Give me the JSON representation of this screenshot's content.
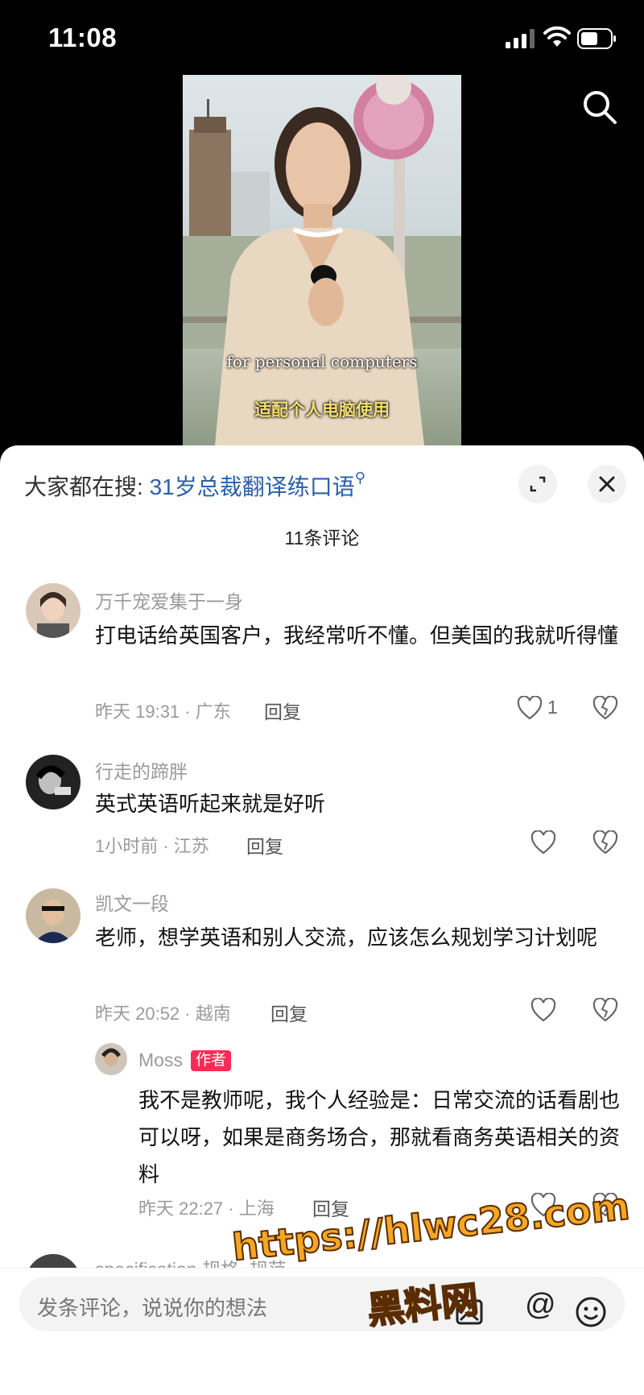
{
  "status": {
    "time": "11:08"
  },
  "video": {
    "subtitle_en": "for personal computers",
    "subtitle_cn": "适配个人电脑使用"
  },
  "sheet": {
    "hot_search_prefix": "大家都在搜: ",
    "hot_search_keyword": "31岁总裁翻译练口语",
    "comment_count": "11条评论"
  },
  "comments": [
    {
      "user": "万千宠爱集于一身",
      "text": "打电话给英国客户，我经常听不懂。但美国的我就听得懂",
      "meta": "昨天 19:31 · 广东",
      "reply_label": "回复",
      "likes": "1"
    },
    {
      "user": "行走的蹄胖",
      "text": "英式英语听起来就是好听",
      "meta": "1小时前 · 江苏",
      "reply_label": "回复",
      "likes": ""
    },
    {
      "user": "凯文一段",
      "text": "老师，想学英语和别人交流，应该怎么规划学习计划呢",
      "meta": "昨天 20:52 · 越南",
      "reply_label": "回复",
      "likes": ""
    }
  ],
  "author_reply": {
    "user": "Moss",
    "badge": "作者",
    "text": "我不是教师呢，我个人经验是：日常交流的话看剧也可以呀，如果是商务场合，那就看商务英语相关的资料",
    "meta": "昨天 22:27 · 上海",
    "reply_label": "回复"
  },
  "partial_next_user": "specification 规格, 规范",
  "input": {
    "placeholder": "发条评论，说说你的想法",
    "at_symbol": "@"
  },
  "watermark": {
    "line1": "https://hlwc28.com",
    "line2": "黑料网"
  },
  "colors": {
    "accent": "#fe2c55",
    "link": "#2b5fa8",
    "subtitle_cn": "#f4df73"
  }
}
